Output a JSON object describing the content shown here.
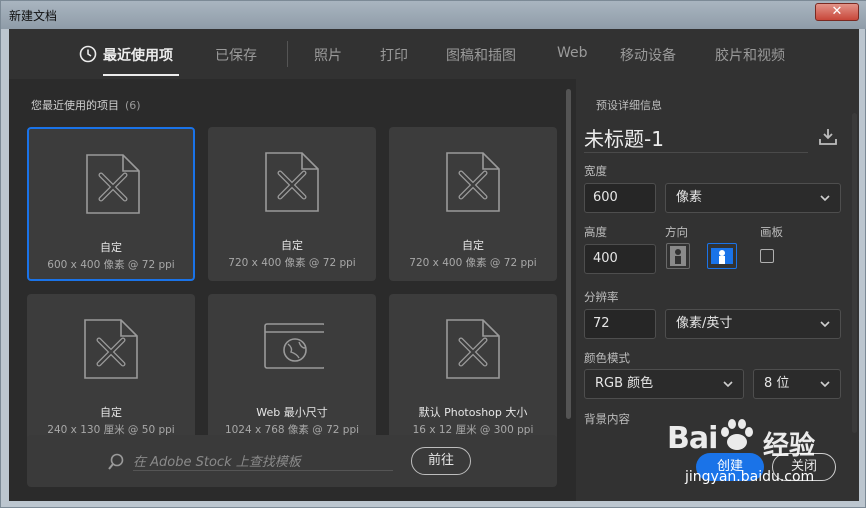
{
  "window": {
    "title": "新建文档",
    "close_glyph": "✕"
  },
  "tabs": [
    {
      "label": "最近使用项",
      "active": true
    },
    {
      "label": "已保存"
    },
    {
      "label": "照片"
    },
    {
      "label": "打印"
    },
    {
      "label": "图稿和插图"
    },
    {
      "label": "Web"
    },
    {
      "label": "移动设备"
    },
    {
      "label": "胶片和视频"
    }
  ],
  "recent": {
    "title": "您最近使用的项目",
    "count": "(6)",
    "items": [
      {
        "name": "自定",
        "size": "600 x 400 像素 @ 72 ppi",
        "icon": "document-ruler-icon"
      },
      {
        "name": "自定",
        "size": "720 x 400 像素 @ 72 ppi",
        "icon": "document-ruler-icon"
      },
      {
        "name": "自定",
        "size": "720 x 400 像素 @ 72 ppi",
        "icon": "document-ruler-icon"
      },
      {
        "name": "自定",
        "size": "240 x 130 厘米 @ 50 ppi",
        "icon": "document-ruler-icon"
      },
      {
        "name": "Web 最小尺寸",
        "size": "1024 x 768 像素 @ 72 ppi",
        "icon": "web-globe-icon"
      },
      {
        "name": "默认 Photoshop 大小",
        "size": "16 x 12 厘米 @ 300 ppi",
        "icon": "document-ruler-icon"
      }
    ]
  },
  "search": {
    "placeholder": "在 Adobe Stock 上查找模板",
    "go_label": "前往"
  },
  "details": {
    "title": "预设详细信息",
    "doc_name": "未标题-1",
    "width_label": "宽度",
    "width_value": "600",
    "width_unit": "像素",
    "height_label": "高度",
    "height_value": "400",
    "orientation_label": "方向",
    "artboard_label": "画板",
    "resolution_label": "分辨率",
    "resolution_value": "72",
    "resolution_unit": "像素/英寸",
    "color_mode_label": "颜色模式",
    "color_mode_value": "RGB 颜色",
    "bit_depth_value": "8 位",
    "background_label": "背景内容"
  },
  "actions": {
    "create_label": "创建",
    "close_label": "关闭"
  },
  "watermark": {
    "brand_left": "Bai",
    "brand_right": "经验",
    "url": "jingyan.baidu.com"
  },
  "colors": {
    "accent": "#1a73e8",
    "panel": "#323232",
    "card": "#3c3c3c"
  }
}
